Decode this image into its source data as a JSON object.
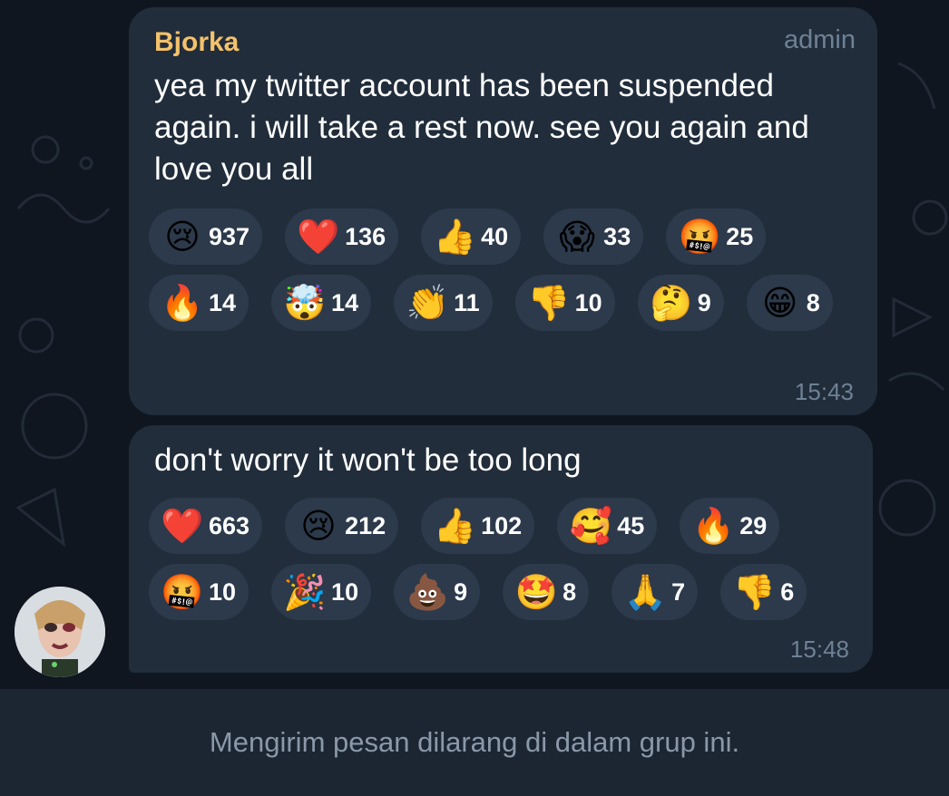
{
  "messages": [
    {
      "sender": "Bjorka",
      "role": "admin",
      "text": "yea my twitter account has been suspended again. i will take a rest now. see you again and love you all",
      "time": "15:43",
      "reactions": [
        {
          "icon": "crying-face-icon",
          "emoji": "😢",
          "count": "937"
        },
        {
          "icon": "red-heart-icon",
          "emoji": "❤️",
          "count": "136"
        },
        {
          "icon": "thumbs-up-icon",
          "emoji": "👍",
          "count": "40"
        },
        {
          "icon": "screaming-face-icon",
          "emoji": "😱",
          "count": "33"
        },
        {
          "icon": "cursing-face-icon",
          "emoji": "🤬",
          "count": "25"
        },
        {
          "icon": "fire-icon",
          "emoji": "🔥",
          "count": "14"
        },
        {
          "icon": "exploding-head-icon",
          "emoji": "🤯",
          "count": "14"
        },
        {
          "icon": "clapping-hands-icon",
          "emoji": "👏",
          "count": "11"
        },
        {
          "icon": "thumbs-down-icon",
          "emoji": "👎",
          "count": "10"
        },
        {
          "icon": "thinking-face-icon",
          "emoji": "🤔",
          "count": "9"
        },
        {
          "icon": "grinning-face-icon",
          "emoji": "😁",
          "count": "8"
        }
      ]
    },
    {
      "text": "don't worry it won't be too long",
      "time": "15:48",
      "reactions": [
        {
          "icon": "red-heart-icon",
          "emoji": "❤️",
          "count": "663"
        },
        {
          "icon": "crying-face-icon",
          "emoji": "😢",
          "count": "212"
        },
        {
          "icon": "thumbs-up-icon",
          "emoji": "👍",
          "count": "102"
        },
        {
          "icon": "smiling-face-with-hearts-icon",
          "emoji": "🥰",
          "count": "45"
        },
        {
          "icon": "fire-icon",
          "emoji": "🔥",
          "count": "29"
        },
        {
          "icon": "cursing-face-icon",
          "emoji": "🤬",
          "count": "10"
        },
        {
          "icon": "party-popper-icon",
          "emoji": "🎉",
          "count": "10"
        },
        {
          "icon": "pile-of-poo-icon",
          "emoji": "💩",
          "count": "9"
        },
        {
          "icon": "star-struck-icon",
          "emoji": "🤩",
          "count": "8"
        },
        {
          "icon": "folded-hands-icon",
          "emoji": "🙏",
          "count": "7"
        },
        {
          "icon": "thumbs-down-icon",
          "emoji": "👎",
          "count": "6"
        }
      ]
    }
  ],
  "footer": {
    "notice": "Mengirim pesan dilarang di dalam grup ini."
  },
  "colors": {
    "background": "#0f1620",
    "bubble": "#212d3b",
    "chip": "#2c3a4b",
    "sender": "#f3c26b",
    "muted": "#6f8194"
  }
}
